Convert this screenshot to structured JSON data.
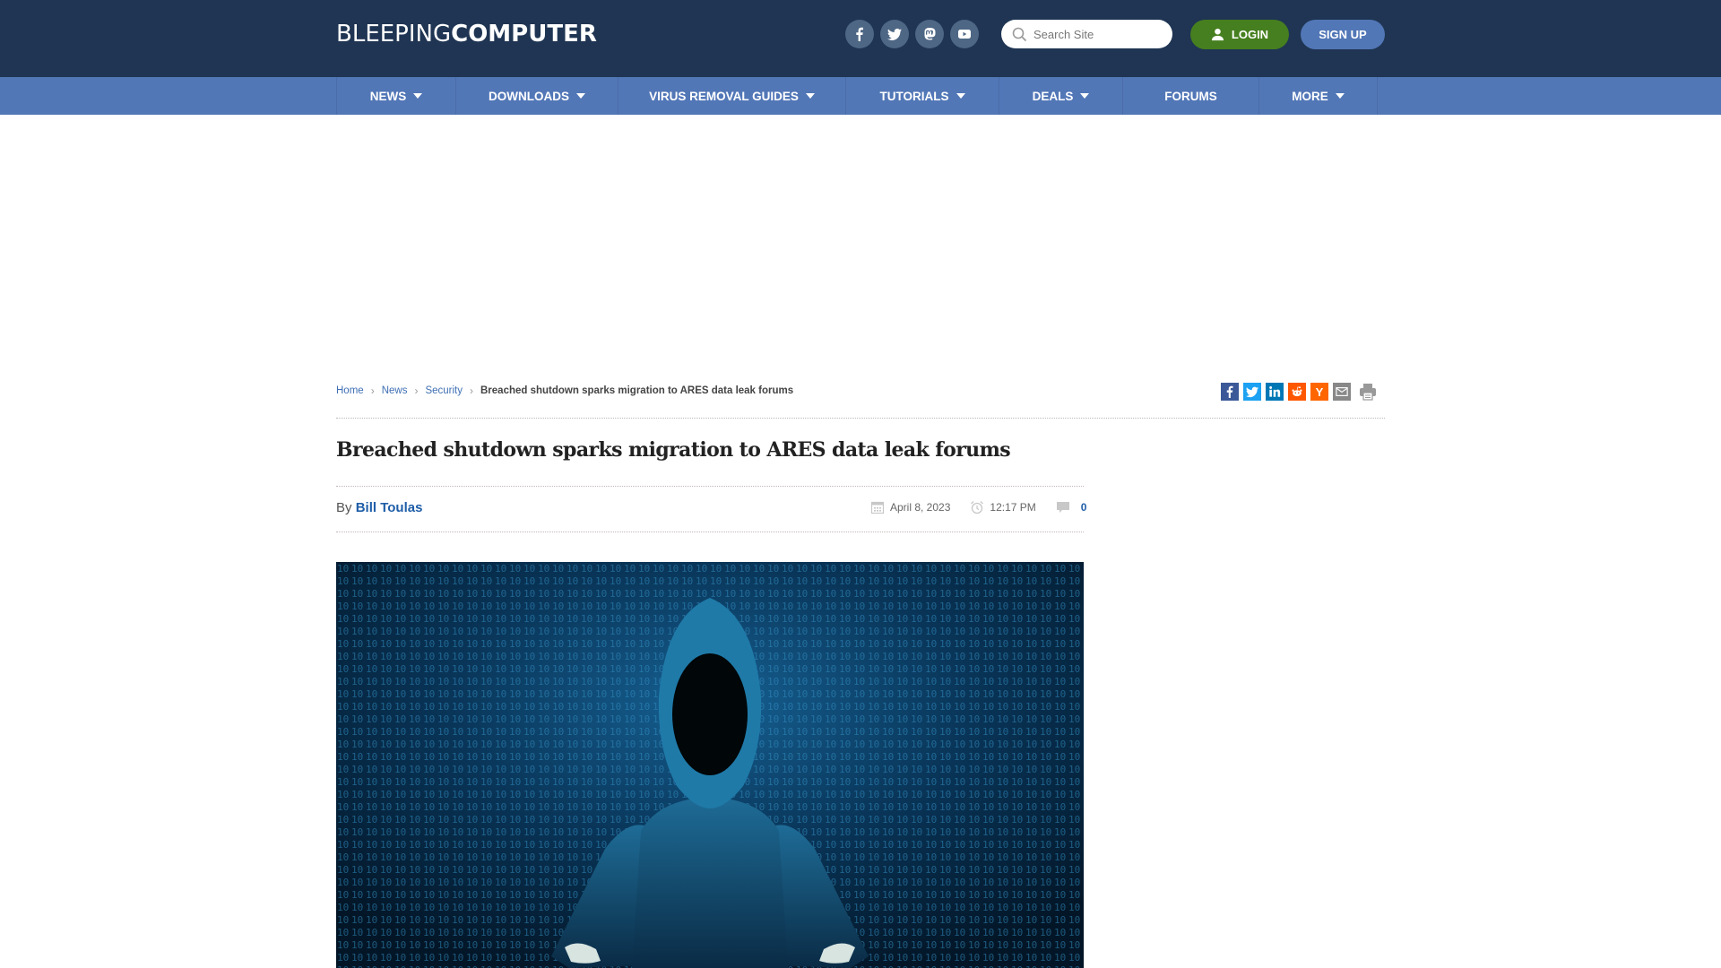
{
  "site": {
    "logo_light": "BLEEPING",
    "logo_bold": "COMPUTER"
  },
  "header": {
    "socials": [
      {
        "name": "facebook",
        "icon": "facebook-icon"
      },
      {
        "name": "twitter",
        "icon": "twitter-icon"
      },
      {
        "name": "mastodon",
        "icon": "mastodon-icon"
      },
      {
        "name": "youtube",
        "icon": "youtube-icon"
      }
    ],
    "search": {
      "placeholder": "Search Site",
      "value": ""
    },
    "login_label": "LOGIN",
    "signup_label": "SIGN UP"
  },
  "nav": {
    "items": [
      {
        "label": "NEWS",
        "dropdown": true
      },
      {
        "label": "DOWNLOADS",
        "dropdown": true
      },
      {
        "label": "VIRUS REMOVAL GUIDES",
        "dropdown": true
      },
      {
        "label": "TUTORIALS",
        "dropdown": true
      },
      {
        "label": "DEALS",
        "dropdown": true
      },
      {
        "label": "FORUMS",
        "dropdown": false
      },
      {
        "label": "MORE",
        "dropdown": true
      }
    ]
  },
  "breadcrumb": {
    "items": [
      "Home",
      "News",
      "Security"
    ],
    "current": "Breached shutdown sparks migration to ARES data leak forums"
  },
  "share": {
    "buttons": [
      {
        "name": "facebook",
        "color": "#3b5998"
      },
      {
        "name": "twitter",
        "color": "#1da1f2"
      },
      {
        "name": "linkedin",
        "color": "#0077b5"
      },
      {
        "name": "reddit",
        "color": "#ff5700"
      },
      {
        "name": "hackernews",
        "color": "#ff6600",
        "glyph": "Y"
      },
      {
        "name": "email",
        "color": "#888888"
      },
      {
        "name": "print",
        "color": "#999999"
      }
    ]
  },
  "article": {
    "title": "Breached shutdown sparks migration to ARES data leak forums",
    "by_label": "By",
    "author": "Bill Toulas",
    "date": "April 8, 2023",
    "time": "12:17 PM",
    "comments": "0"
  },
  "colors": {
    "header_bg": "#1f3553",
    "nav_bg": "#5277b7",
    "login_green": "#467f1f",
    "link_blue": "#1f5ea8"
  }
}
